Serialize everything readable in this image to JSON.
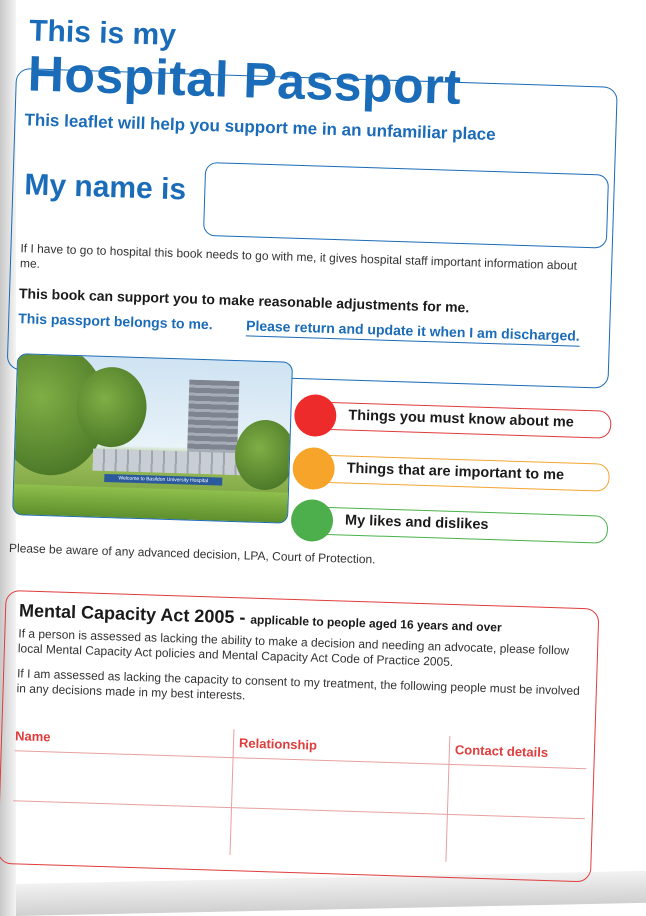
{
  "header": {
    "title_line1": "This is my",
    "title_line2": "Hospital Passport",
    "subtitle": "This leaflet will help you support me in an unfamiliar place"
  },
  "name_section": {
    "label": "My name is",
    "value": ""
  },
  "intro": {
    "body": "If I have to go to hospital this book needs to go with me, it gives hospital staff important information about me.",
    "support": "This book can support you to make reasonable adjustments for me.",
    "belongs": "This passport belongs to me.",
    "return_note": "Please return and update it when I am discharged."
  },
  "photo": {
    "sign_text": "Welcome to Basildon University Hospital"
  },
  "traffic_lights": [
    {
      "label": "Things you must know about me",
      "color": "#ee2b2b"
    },
    {
      "label": "Things that are important to me",
      "color": "#f7a52a"
    },
    {
      "label": "My likes and dislikes",
      "color": "#4caf4c"
    }
  ],
  "aware_note": "Please be aware of any advanced decision, LPA, Court of Protection.",
  "mca": {
    "title": "Mental Capacity Act 2005 -",
    "subtitle": "applicable to people aged 16 years and over",
    "para1": "If a person is assessed as lacking the ability to make a decision and needing an advocate, please follow local Mental Capacity Act policies and Mental Capacity Act Code of Practice 2005.",
    "para2": "If I am assessed as lacking the capacity to consent to my treatment, the following people must be involved in any decisions made in my best interests.",
    "columns": [
      "Name",
      "Relationship",
      "Contact details"
    ]
  },
  "colors": {
    "blue": "#1a6bb8",
    "red": "#e03c3c",
    "orange": "#f4a431",
    "green": "#49b249"
  }
}
